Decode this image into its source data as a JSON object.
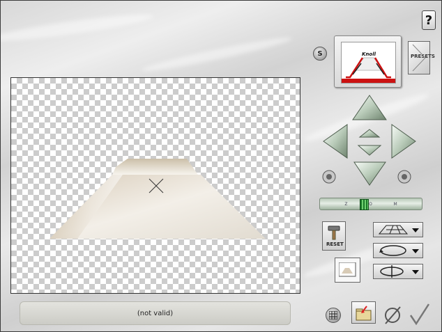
{
  "status": {
    "text": "(not valid)"
  },
  "presets": {
    "label": "PRESETS"
  },
  "preview": {
    "logo_text": "Knoll"
  },
  "reset": {
    "label": "RESET"
  },
  "slider": {
    "marks": [
      "Z",
      "O",
      "M"
    ]
  },
  "help": {
    "label": "?"
  },
  "s_button": {
    "label": "S"
  },
  "icons": {
    "nav_up": "arrow-up-icon",
    "nav_down": "arrow-down-icon",
    "nav_left": "arrow-left-icon",
    "nav_right": "arrow-right-icon",
    "small_up": "small-up-icon",
    "small_down": "small-down-icon",
    "rotate_left": "rotate-left-icon",
    "rotate_right": "rotate-right-icon",
    "hammer": "hammer-icon",
    "perspective_grid": "perspective-grid-icon",
    "rotate_loop": "rotate-loop-icon",
    "flip_axis": "flip-axis-icon",
    "grid_toggle": "grid-icon",
    "folder": "folder-icon",
    "cancel": "cancel-icon",
    "ok": "checkmark-icon"
  },
  "colors": {
    "shape_light": "#f4f0e8",
    "shape_dark": "#c9bba6",
    "slider_thumb": "#2c9a3a",
    "preview_lines": "#cc1111"
  }
}
